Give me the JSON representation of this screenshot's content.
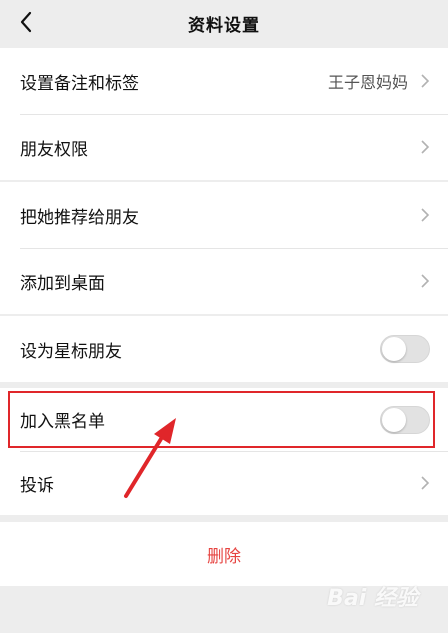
{
  "header": {
    "title": "资料设置",
    "back_icon": "chevron-left-icon"
  },
  "group1": {
    "remark": {
      "label": "设置备注和标签",
      "value": "王子恩妈妈"
    },
    "permission": {
      "label": "朋友权限"
    }
  },
  "group2": {
    "recommend": {
      "label": "把她推荐给朋友"
    },
    "add_desktop": {
      "label": "添加到桌面"
    }
  },
  "group3": {
    "star": {
      "label": "设为星标朋友",
      "on": false
    }
  },
  "group4": {
    "blacklist": {
      "label": "加入黑名单",
      "on": false
    },
    "complain": {
      "label": "投诉"
    }
  },
  "delete": {
    "label": "删除"
  },
  "colors": {
    "delete_red": "#e64340",
    "highlight_red": "#e0262a"
  },
  "watermark": "Bai 经验"
}
